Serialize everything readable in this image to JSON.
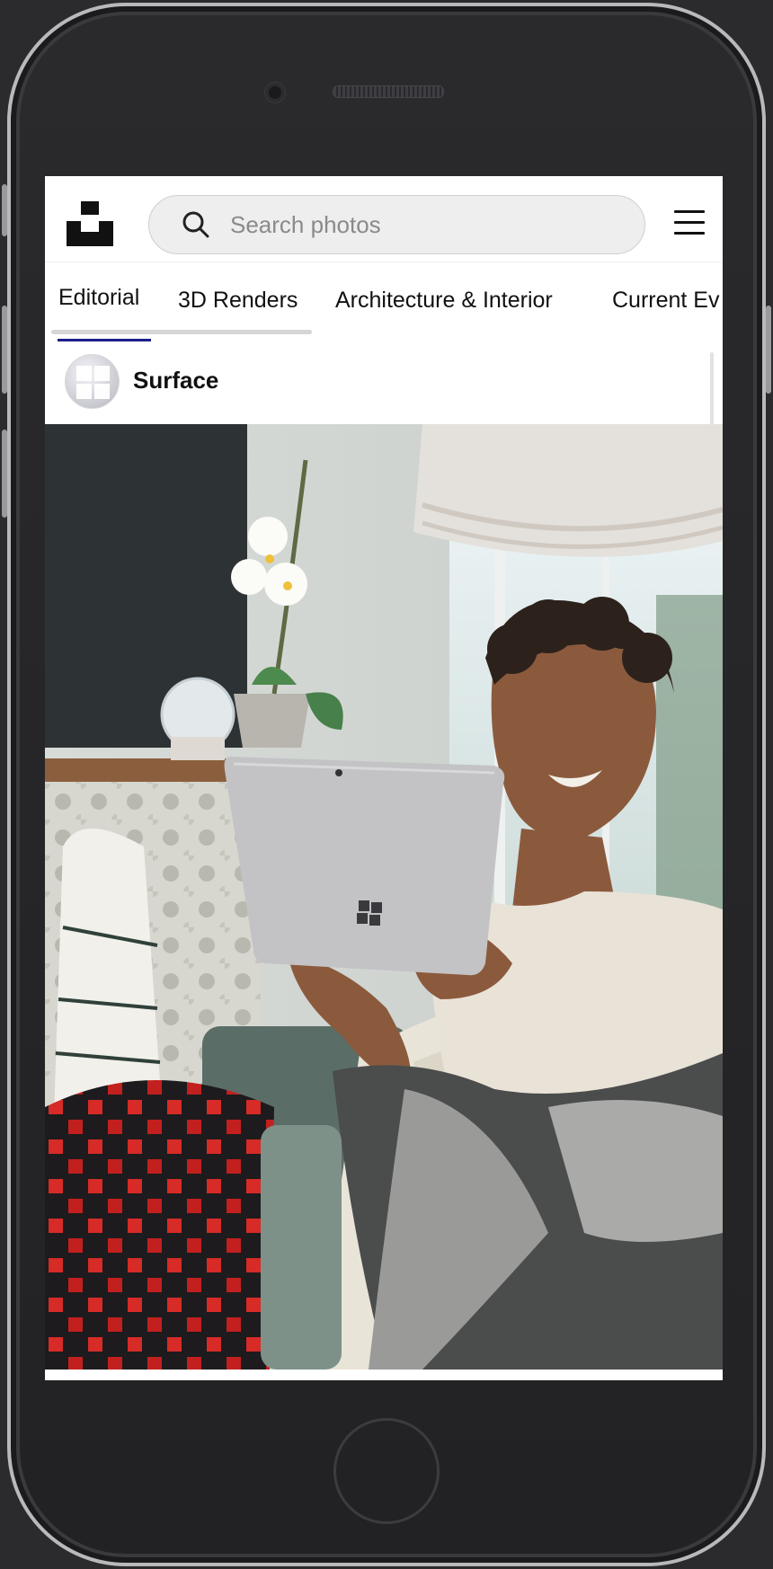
{
  "search": {
    "placeholder": "Search photos"
  },
  "tabs": [
    {
      "label": "Editorial",
      "selected": true
    },
    {
      "label": "3D Renders",
      "selected": false
    },
    {
      "label": "Architecture & Interior",
      "selected": false
    },
    {
      "label": "Current Ev",
      "selected": false
    }
  ],
  "account": {
    "name": "Surface"
  },
  "photo": {
    "subject": "person-smiling-with-tablet"
  },
  "icons": {
    "logo": "unsplash-logo",
    "search": "search-icon",
    "menu": "hamburger-menu-icon",
    "avatar": "windows-logo-icon"
  },
  "colors": {
    "tab_underline": "#1a1f8a",
    "search_background": "#eeeeee"
  }
}
